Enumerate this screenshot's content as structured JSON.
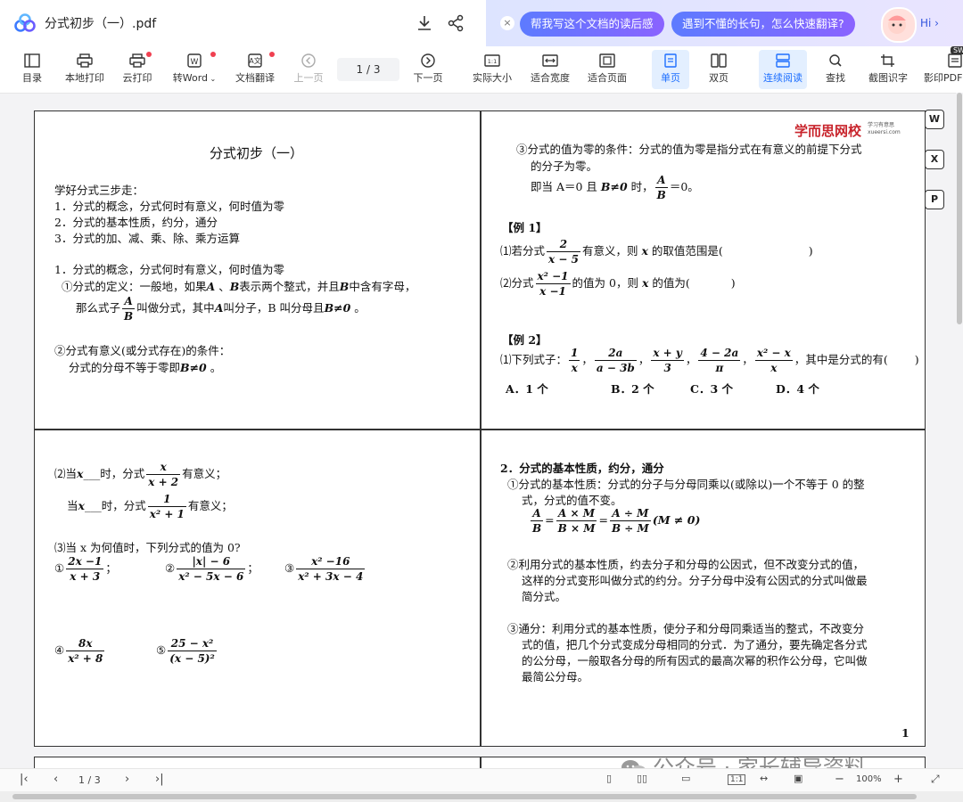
{
  "topbar": {
    "title": "分式初步（一）.pdf",
    "ai_close": "×",
    "chips": [
      "帮我写这个文档的读后感",
      "遇到不懂的长句，怎么快速翻译?"
    ],
    "hi": "Hi ›"
  },
  "toolbar": {
    "items": [
      {
        "label": "目录",
        "icon": "catalog-icon"
      },
      {
        "label": "本地打印",
        "icon": "printer-icon"
      },
      {
        "label": "云打印",
        "icon": "cloud-print-icon"
      },
      {
        "label": "转Word",
        "icon": "word-icon"
      },
      {
        "label": "文档翻译",
        "icon": "translate-icon"
      },
      {
        "label": "上一页",
        "icon": "prev-page-icon"
      },
      {
        "label": "下一页",
        "icon": "next-page-icon"
      },
      {
        "label": "实际大小",
        "icon": "actual-size-icon"
      },
      {
        "label": "适合宽度",
        "icon": "fit-width-icon"
      },
      {
        "label": "适合页面",
        "icon": "fit-page-icon"
      },
      {
        "label": "单页",
        "icon": "single-page-icon"
      },
      {
        "label": "双页",
        "icon": "double-page-icon"
      },
      {
        "label": "连续阅读",
        "icon": "continuous-icon"
      },
      {
        "label": "查找",
        "icon": "search-icon"
      },
      {
        "label": "截图识字",
        "icon": "screenshot-ocr-icon"
      },
      {
        "label": "影印PDF",
        "icon": "photocopy-icon"
      }
    ],
    "page_indicator": "1 / 3",
    "sw_badge": "SW"
  },
  "doc": {
    "q1": {
      "title": "分式初步（一）",
      "intro": "学好分式三步走：",
      "step1": "1．分式的概念，分式何时有意义，何时值为零",
      "step2": "2．分式的基本性质，约分，通分",
      "step3": "3．分式的加、减、乘、除、乘方运算",
      "sec1": "1．分式的概念，分式何时有意义，何时值为零",
      "def_a": "①分式的定义：一般地，如果",
      "A": "A",
      "dunhao": " 、",
      "B": "B",
      "def_b": "表示两个整式，并且",
      "def_c": "中含有字母，",
      "def_d": "那么式子",
      "frac_num": "A",
      "frac_den": "B",
      "def_e": "叫做分式，其中",
      "def_f": "叫分子，B 叫分母且",
      "bneq0": "B≠0",
      "period": " 。",
      "cond_title": "②分式有意义(或分式存在)的条件：",
      "cond_body": "分式的分母不等于零即",
      "cond_end": " 。"
    },
    "q2": {
      "brand": "学而思网校",
      "brand_sub": "学习有意思",
      "brand_url": "xueersi.com",
      "zero_a": "③分式的值为零的条件：分式的值为零是指分式在有意义的前提下分式",
      "zero_b": "的分子为零。",
      "zero_c": "即当 A＝0 且",
      "bneq0": "B≠0",
      "zero_d": "时，",
      "frac_num": "A",
      "frac_den": "B",
      "eq0": "＝0。",
      "ex1": "【例 1】",
      "ex1_1a": "⑴若分式",
      "ex1_1num": "2",
      "ex1_1den": "x − 5",
      "ex1_1b": "有意义，则",
      "x": "x",
      "ex1_1c": "的取值范围是(",
      "rparen": ")",
      "ex1_2a": "⑵分式",
      "ex1_2num": "x² −1",
      "ex1_2den": "x −1",
      "ex1_2b": "的值为 0，则",
      "ex1_2c": "的值为(",
      "ex2": "【例 2】",
      "ex2_a": "⑴下列式子：",
      "f1n": "1",
      "f1d": "x",
      "f2n": "2a",
      "f2d": "a − 3b",
      "f3n": "x + y",
      "f3d": "3",
      "f4n": "4 − 2a",
      "f4d": "π",
      "f5n": "x² − x",
      "f5d": "x",
      "comma": "，",
      "ex2_b": "其中是分式的有(",
      "optA": "A．1 个",
      "optB": "B．2 个",
      "optC": "C．3 个",
      "optD": "D．4 个"
    },
    "q3": {
      "p2a": "⑵当",
      "x": "x",
      "blank": "___",
      "p2b": "时，分式",
      "f1n": "x",
      "f1d": "x + 2",
      "p2c": "有意义；",
      "p2d": "当",
      "f2n": "1",
      "f2d": "x² + 1",
      "p3": "⑶当 x 为何值时，下列分式的值为 0?",
      "c1": "①",
      "c1n": "2x −1",
      "c1d": "x + 3",
      "semi": "；",
      "c2": "②",
      "c2n": "|x| − 6",
      "c2d": "x² − 5x − 6",
      "c3": "③",
      "c3n": "x² −16",
      "c3d": "x² + 3x − 4",
      "c4": "④",
      "c4n": "8x",
      "c4d": "x² + 8",
      "c5": "⑤",
      "c5n": "25 − x²",
      "c5d": "(x − 5)²"
    },
    "q4": {
      "title": "2．分式的基本性质，约分，通分",
      "p1a": "①分式的基本性质：分式的分子与分母同乘以(或除以)一个不等于 0 的整",
      "p1b": "式，分式的值不变。",
      "fa_n": "A",
      "fa_d": "B",
      "eq": "=",
      "fb_n": "A × M",
      "fb_d": "B × M",
      "fc_n": "A ÷ M",
      "fc_d": "B ÷ M",
      "cond": "(M ≠ 0)",
      "p2a": "②利用分式的基本性质，约去分子和分母的公因式，但不改变分式的值，",
      "p2b": "这样的分式变形叫做分式的约分。分子分母中没有公因式的分式叫做最",
      "p2c": "简分式。",
      "p3a": "③通分：利用分式的基本性质，使分子和分母同乘适当的整式，不改变分",
      "p3b": "式的值，把几个分式变成分母相同的分式．为了通分，要先确定各分式",
      "p3c": "的公分母，一般取各分母的所有因式的最高次幂的积作公分母，它叫做",
      "p3d": "最简公分母。",
      "page_num": "1"
    }
  },
  "bottom": {
    "page": "1 / 3",
    "zoom": "100%",
    "zoom_minus": "−",
    "zoom_plus": "+",
    "watermark": "公众号 · 家长辅导资料"
  }
}
